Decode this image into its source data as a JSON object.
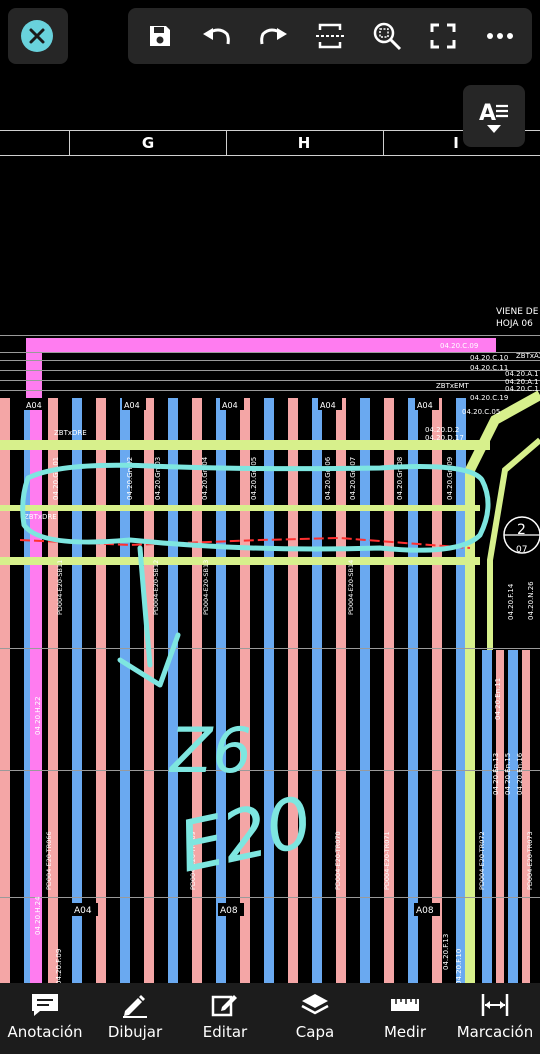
{
  "toolbar": {
    "close": "close-icon",
    "buttons": [
      "save-icon",
      "undo-icon",
      "redo-icon",
      "fit-width-icon",
      "zoom-icon",
      "fullscreen-icon",
      "more-icon"
    ]
  },
  "drawing": {
    "columns": [
      "G",
      "H",
      "I"
    ],
    "viene_de": "VIENE DE",
    "hoja": "HOJA 06",
    "bus_labels": [
      "A04",
      "A04",
      "A04",
      "A04",
      "A04"
    ],
    "bus_labels_bottom": [
      "A04",
      "A08",
      "A08"
    ],
    "refs_top": [
      "04.20.C.09",
      "04.20.C.10",
      "04.20.C.11",
      "04.20.A.1",
      "04.20.A.1",
      "04.20.C.1",
      "04.20.C.19",
      "04.20.C.05",
      "04.20.D.2",
      "04.20.D.17"
    ],
    "tags": [
      "ZBTxDRE",
      "ZBTxDRE",
      "ZBTxEMT",
      "ZBTxAX"
    ],
    "circle_num": "2",
    "circle_sub": "07",
    "handwriting": [
      "Z6",
      "E20"
    ],
    "vertical_codes": [
      "04.20.Gn.01",
      "04.20.Gn.02",
      "04.20.Gn.03",
      "04.20.Gn.04",
      "04.20.Gn.05",
      "04.20.Gn.06",
      "04.20.Gn.07",
      "04.20.Gn.08",
      "04.20.Gn.09",
      "04.20.F.14",
      "04.20.N.26",
      "04.20.H.22",
      "04.20.H.24",
      "04.20.En.11",
      "04.20.En.13",
      "04.20.En.15",
      "04.20.En.16",
      "04.20.F.13",
      "04.20.F.09",
      "04.20.F.10"
    ],
    "cable_codes": [
      "PD004-E20-SB11",
      "PD004-E20-SB12",
      "PD004-E20-SB13",
      "PD004-E20-SB14",
      "PD004-E20-TR066",
      "PD004-E20-TR069",
      "PD004-E20-TR070",
      "PD004-E20-TR071",
      "PD004-E20-TR072",
      "PD004-E20-TR073"
    ]
  },
  "colors": {
    "pink": "#f4a6a6",
    "blue": "#6aa9f0",
    "yellow_green": "#d7f08c",
    "magenta": "#ff7cf0",
    "highlight": "#7ee6e0",
    "red": "#ff3030"
  },
  "nav": {
    "items": [
      {
        "label": "Anotación",
        "icon": "comment-icon"
      },
      {
        "label": "Dibujar",
        "icon": "pencil-icon"
      },
      {
        "label": "Editar",
        "icon": "edit-icon"
      },
      {
        "label": "Capa",
        "icon": "layers-icon"
      },
      {
        "label": "Medir",
        "icon": "ruler-icon"
      },
      {
        "label": "Marcación",
        "icon": "measure-arrow-icon"
      }
    ]
  }
}
